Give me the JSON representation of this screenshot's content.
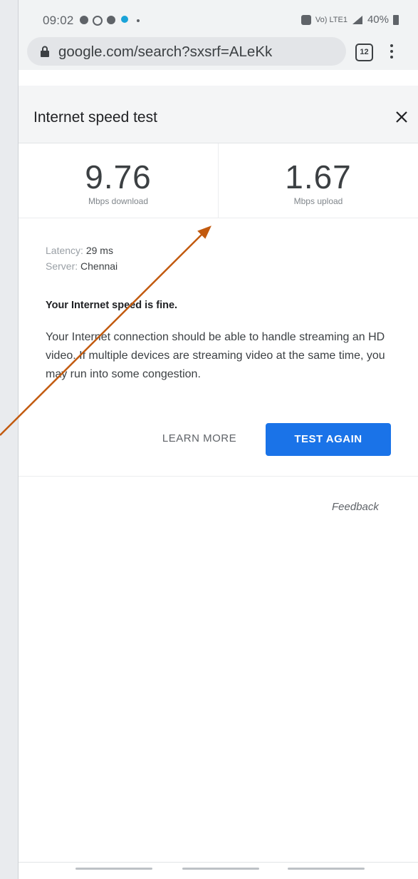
{
  "status_bar": {
    "time": "09:02",
    "signal_text": "Vo) LTE1",
    "battery": "40%"
  },
  "browser": {
    "url": "google.com/search?sxsrf=ALeKk",
    "tab_count": "12"
  },
  "card": {
    "title": "Internet speed test",
    "download": {
      "value": "9.76",
      "label": "Mbps download"
    },
    "upload": {
      "value": "1.67",
      "label": "Mbps upload"
    },
    "latency_label": "Latency:",
    "latency_value": "29 ms",
    "server_label": "Server:",
    "server_value": "Chennai",
    "verdict": "Your Internet speed is fine.",
    "description": "Your Internet connection should be able to handle streaming an HD video. If multiple devices are streaming video at the same time, you may run into some congestion.",
    "learn_more": "LEARN MORE",
    "test_again": "TEST AGAIN",
    "feedback": "Feedback"
  },
  "colors": {
    "accent": "#1a73e8",
    "annotation_arrow": "#c25a0f"
  }
}
